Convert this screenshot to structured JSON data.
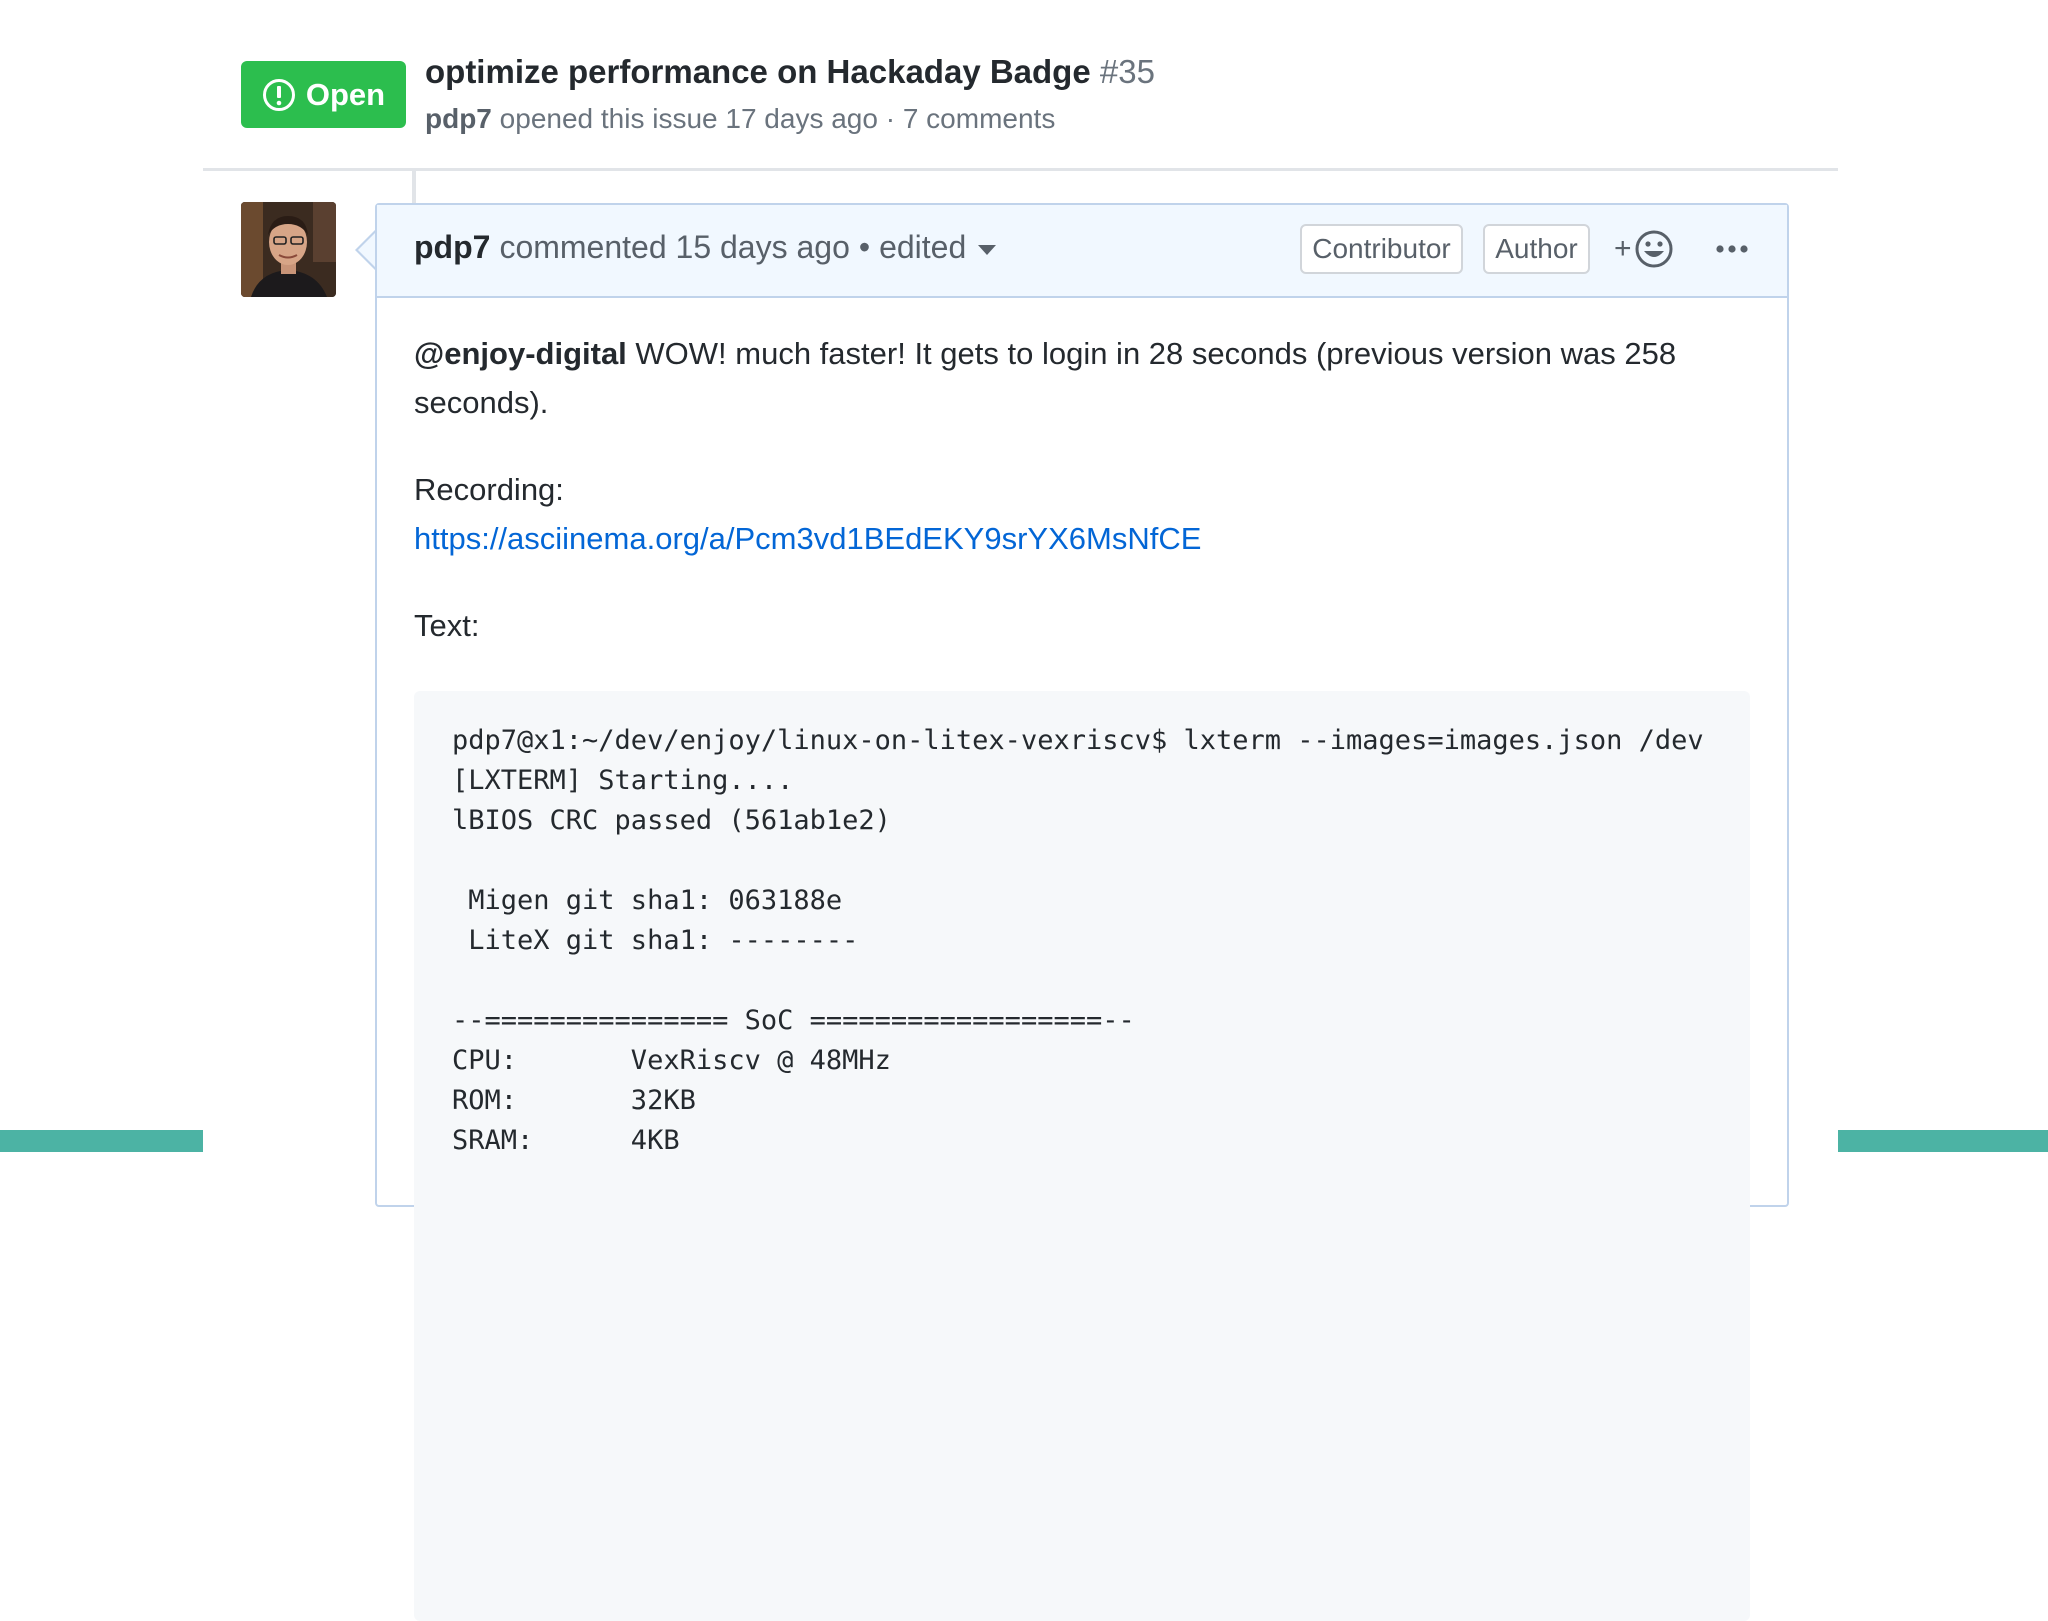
{
  "issue": {
    "state": "Open",
    "title": "optimize performance on Hackaday Badge",
    "number": "#35",
    "author": "pdp7",
    "meta_text": "opened this issue 17 days ago · 7 comments"
  },
  "comment": {
    "author": "pdp7",
    "action": "commented 15 days ago",
    "bullet": "•",
    "edited_label": "edited",
    "roles": {
      "contributor": "Contributor",
      "author": "Author"
    },
    "reaction_plus": "+",
    "body": {
      "mention": "@enjoy-digital",
      "message": " WOW! much faster! It gets to login in 28 seconds (previous version was 258 seconds).",
      "recording_label": "Recording:",
      "recording_link": "https://asciinema.org/a/Pcm3vd1BEdEKY9srYX6MsNfCE",
      "text_label": "Text:",
      "code_lines": [
        "pdp7@x1:~/dev/enjoy/linux-on-litex-vexriscv$ lxterm --images=images.json /dev",
        "[LXTERM] Starting....",
        "lBIOS CRC passed (561ab1e2)",
        "",
        " Migen git sha1: 063188e",
        " LiteX git sha1: --------",
        "",
        "--=============== SoC ==================--",
        "CPU:       VexRiscv @ 48MHz",
        "ROM:       32KB",
        "SRAM:      4KB"
      ]
    }
  },
  "colors": {
    "open_green": "#2cbe4e",
    "link_blue": "#0366d6",
    "teal_bar": "#4cb3a4",
    "comment_header_bg": "#f1f8ff",
    "comment_border": "#c0d3eb"
  },
  "icons": {
    "state": "issue-opened-icon",
    "reaction": "smiley-icon",
    "more": "kebab-horizontal-icon",
    "edited": "triangle-down-icon"
  }
}
